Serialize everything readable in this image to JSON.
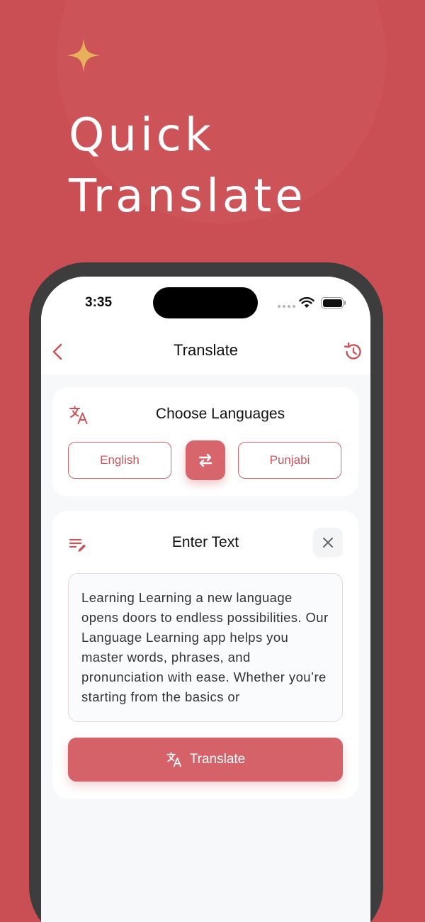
{
  "hero": {
    "line1": "Quick",
    "line2": "Translate"
  },
  "status_bar": {
    "time": "3:35"
  },
  "nav": {
    "title": "Translate"
  },
  "languages": {
    "title": "Choose Languages",
    "from": "English",
    "to": "Punjabi"
  },
  "input": {
    "title": "Enter Text",
    "text": "Learning Learning a new language opens doors to endless possibilities. Our Language Learning app helps you master words, phrases, and pronunciation with ease. Whether you’re starting from the basics or"
  },
  "actions": {
    "translate_label": "Translate"
  },
  "colors": {
    "background": "#c94f55",
    "accent": "#d46268",
    "sparkle": "#e8b05a"
  },
  "icons": [
    "sparkle-icon",
    "back-arrow-icon",
    "history-icon",
    "translate-icon",
    "swap-icon",
    "edit-text-icon",
    "close-icon",
    "wifi-icon",
    "battery-icon"
  ]
}
